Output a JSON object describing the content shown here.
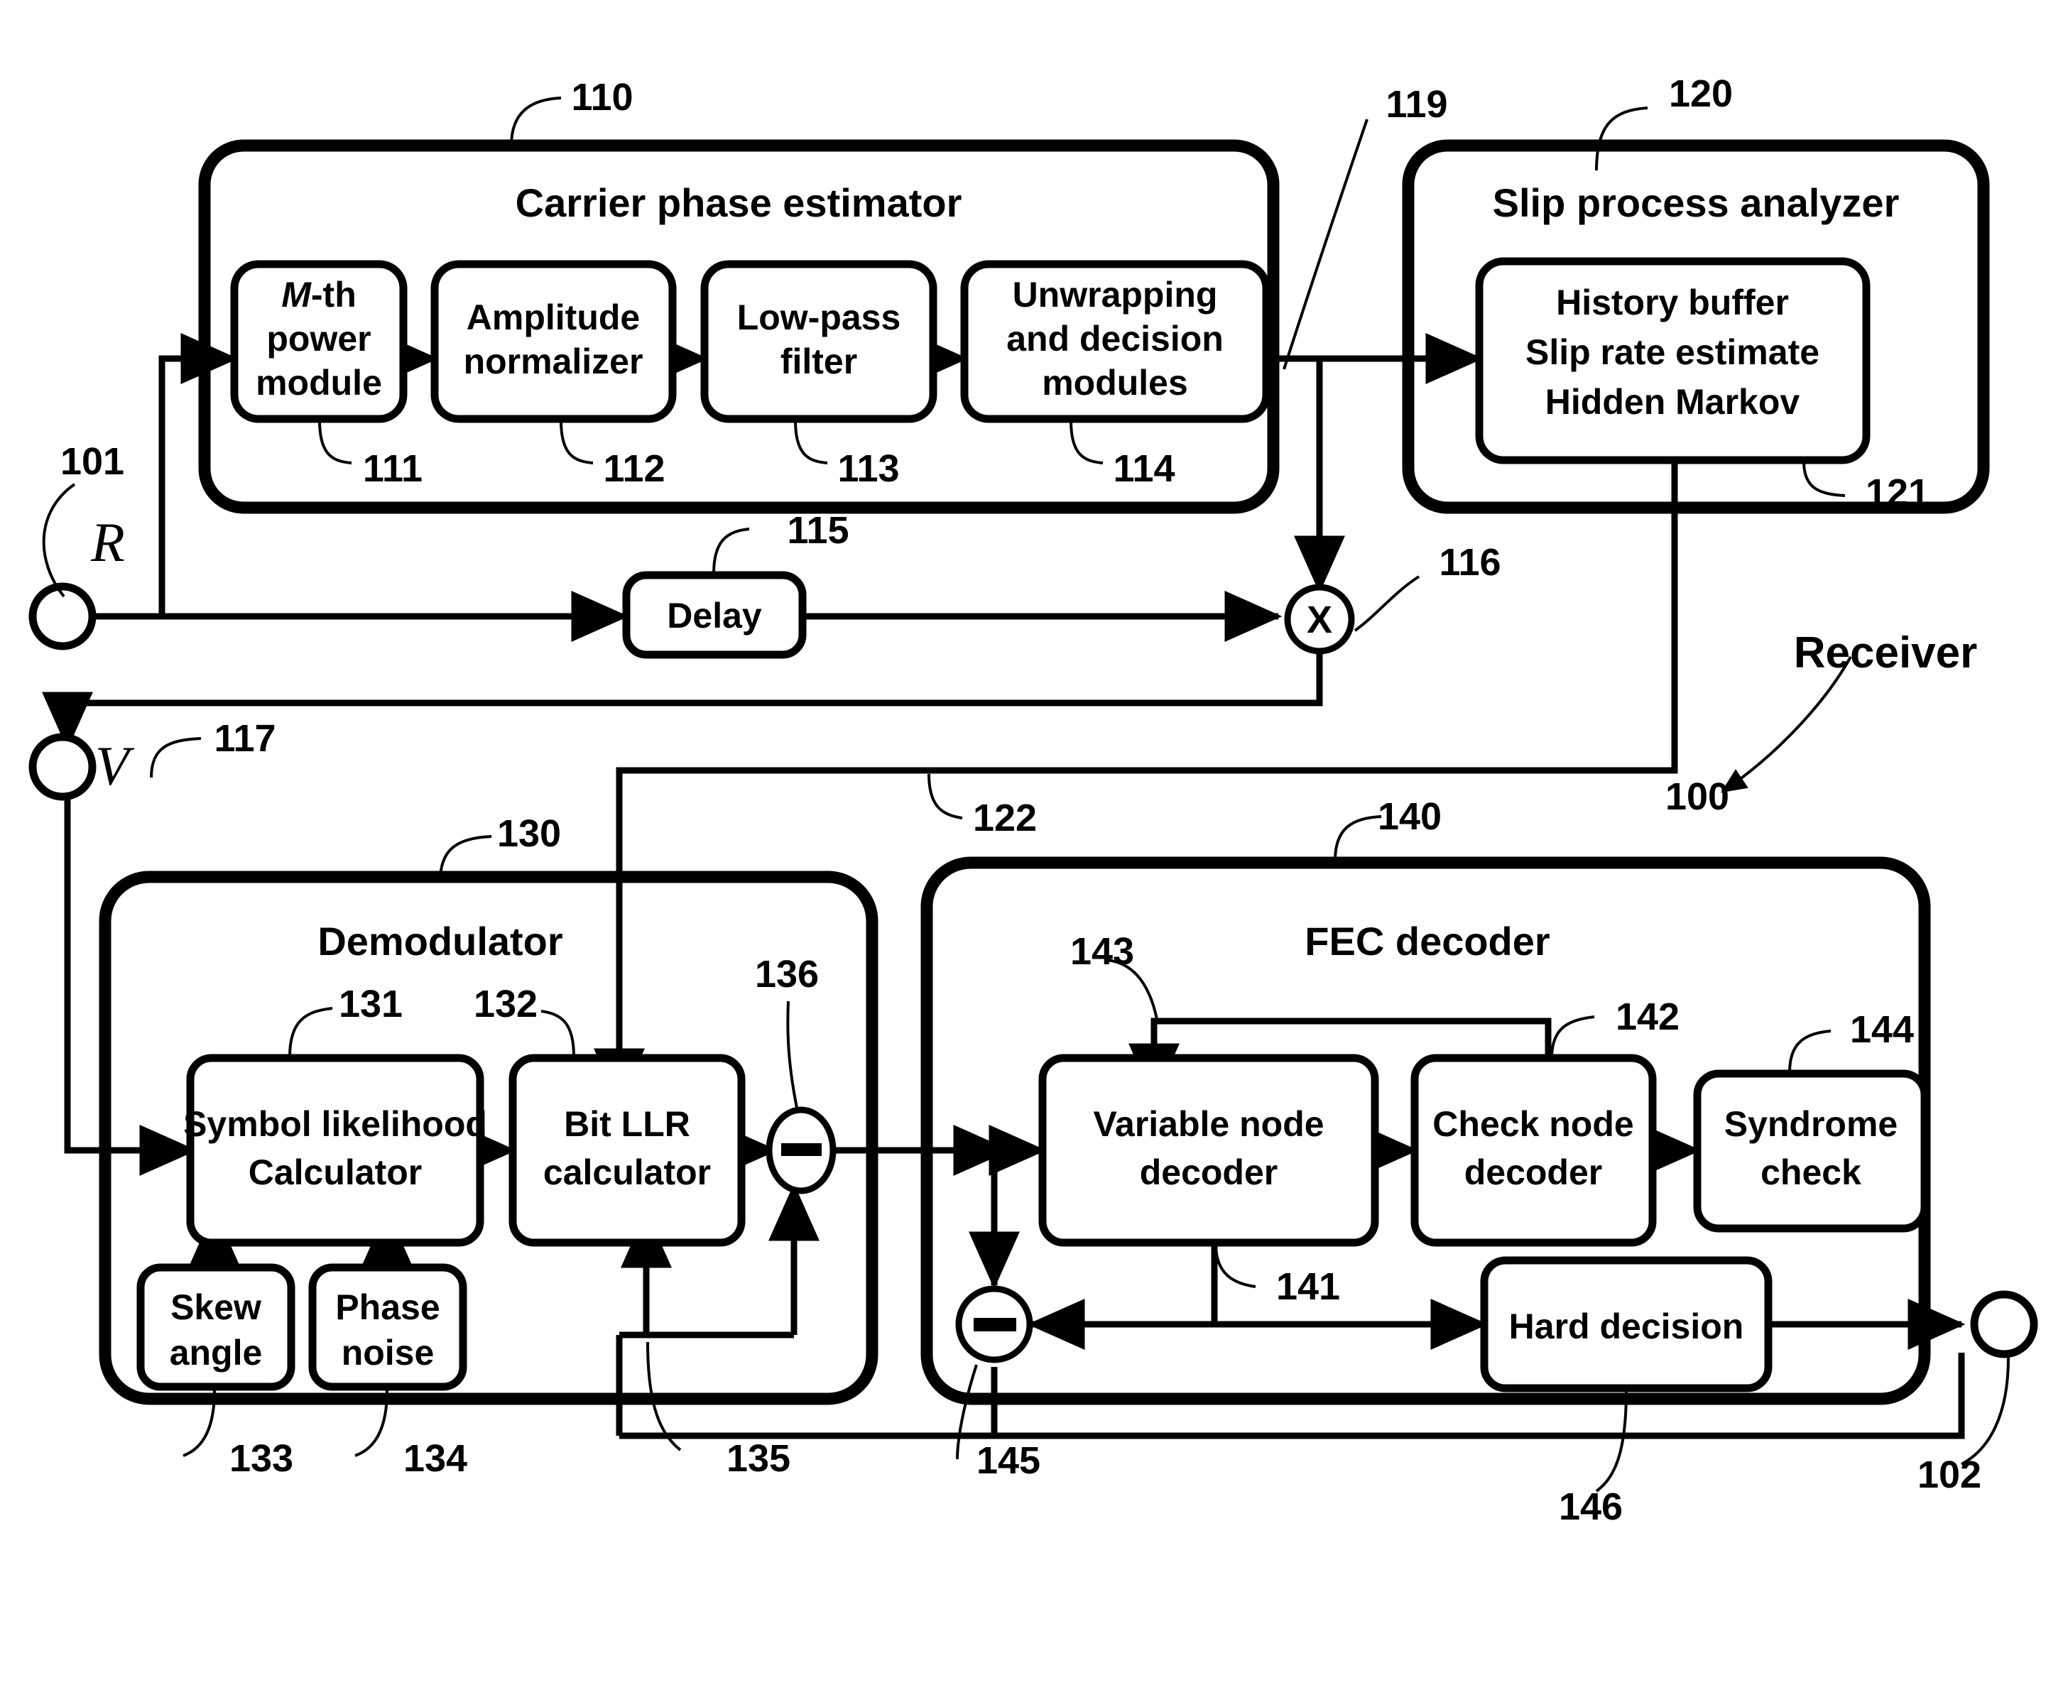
{
  "figure": {
    "receiver_label": "Receiver",
    "receiver_ref": "100",
    "input_port": {
      "label": "R",
      "ref": "101"
    },
    "mid_port": {
      "label": "V",
      "ref": "117"
    },
    "output_port": {
      "ref": "102"
    }
  },
  "carrier_phase_estimator": {
    "title": "Carrier phase estimator",
    "ref": "110",
    "blocks": [
      {
        "ref": "111",
        "lines": [
          "M-th",
          "power",
          "module"
        ],
        "italic_first_word": true
      },
      {
        "ref": "112",
        "lines": [
          "Amplitude",
          "normalizer"
        ]
      },
      {
        "ref": "113",
        "lines": [
          "Low-pass",
          "filter"
        ]
      },
      {
        "ref": "114",
        "lines": [
          "Unwrapping",
          "and decision",
          "modules"
        ]
      }
    ],
    "delay": {
      "ref": "115",
      "label": "Delay"
    },
    "multiplier": {
      "ref": "116",
      "symbol": "X"
    },
    "estimate_line_ref": "119"
  },
  "slip_process_analyzer": {
    "title": "Slip process analyzer",
    "ref": "120",
    "inner": {
      "ref": "121",
      "lines": [
        "History buffer",
        "Slip rate estimate",
        "Hidden Markov"
      ]
    },
    "output_line_ref": "122"
  },
  "demodulator": {
    "title": "Demodulator",
    "ref": "130",
    "blocks": [
      {
        "ref": "131",
        "lines": [
          "Symbol likelihood",
          "Calculator"
        ]
      },
      {
        "ref": "132",
        "lines": [
          "Bit LLR",
          "calculator"
        ]
      },
      {
        "ref": "133",
        "lines": [
          "Skew",
          "angle"
        ]
      },
      {
        "ref": "134",
        "lines": [
          "Phase",
          "noise"
        ]
      }
    ],
    "subtractor": {
      "ref": "136",
      "symbol": "−"
    },
    "feedback_line_ref": "135"
  },
  "fec_decoder": {
    "title": "FEC decoder",
    "ref": "140",
    "blocks": [
      {
        "ref": "141",
        "lines": [
          "Variable node",
          "decoder"
        ]
      },
      {
        "ref": "142",
        "lines": [
          "Check node",
          "decoder"
        ]
      },
      {
        "ref": "144",
        "lines": [
          "Syndrome",
          "check"
        ]
      },
      {
        "ref": "146",
        "lines": [
          "Hard decision"
        ]
      }
    ],
    "subtractor": {
      "ref": "145",
      "symbol": "−"
    },
    "feedback_loop_ref": "143"
  }
}
